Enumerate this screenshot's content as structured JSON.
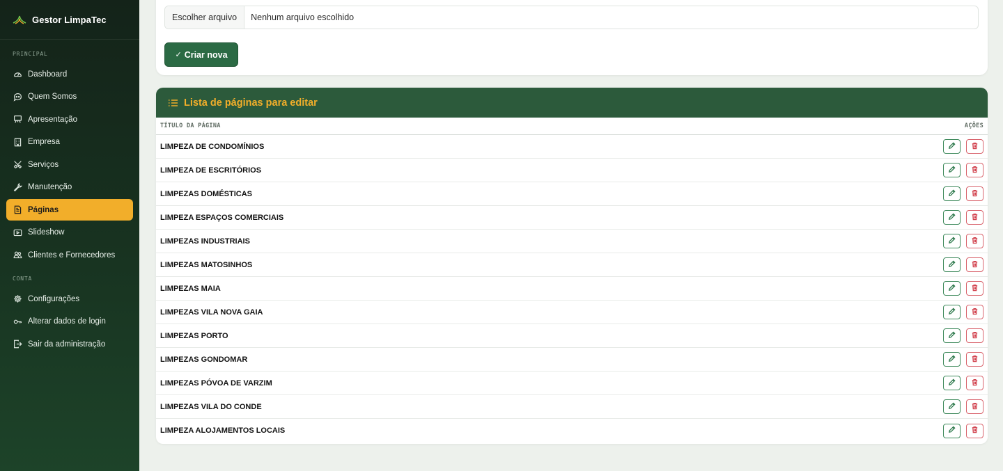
{
  "sidebar": {
    "brand": "Gestor LimpaTec",
    "section_principal": "PRINCIPAL",
    "section_conta": "CONTA",
    "principal_items": [
      {
        "label": "Dashboard",
        "icon": "gauge-icon"
      },
      {
        "label": "Quem Somos",
        "icon": "chat-quote-icon"
      },
      {
        "label": "Apresentação",
        "icon": "easel-icon"
      },
      {
        "label": "Empresa",
        "icon": "building-icon"
      },
      {
        "label": "Serviços",
        "icon": "tools-icon"
      },
      {
        "label": "Manutenção",
        "icon": "wrench-icon"
      },
      {
        "label": "Páginas",
        "icon": "file-text-icon",
        "active": true
      },
      {
        "label": "Slideshow",
        "icon": "slideshow-icon"
      },
      {
        "label": "Clientes e Fornecedores",
        "icon": "people-icon"
      }
    ],
    "conta_items": [
      {
        "label": "Configurações",
        "icon": "gear-icon"
      },
      {
        "label": "Alterar dados de login",
        "icon": "key-icon"
      },
      {
        "label": "Sair da administração",
        "icon": "logout-icon"
      }
    ]
  },
  "upload": {
    "choose_file_label": "Escolher arquivo",
    "no_file_text": "Nenhum arquivo escolhido",
    "create_button": "Criar nova"
  },
  "list": {
    "title": "Lista de páginas para editar",
    "col_title": "TÍTULO DA PÁGINA",
    "col_actions": "AÇÕES",
    "rows": [
      "LIMPEZA DE CONDOMÍNIOS",
      "LIMPEZA DE ESCRITÓRIOS",
      "LIMPEZAS DOMÉSTICAS",
      "LIMPEZA ESPAÇOS COMERCIAIS",
      "LIMPEZAS INDUSTRIAIS",
      "LIMPEZAS MATOSINHOS",
      "LIMPEZAS MAIA",
      "LIMPEZAS VILA NOVA GAIA",
      "LIMPEZAS PORTO",
      "LIMPEZAS GONDOMAR",
      "LIMPEZAS PÓVOA DE VARZIM",
      "LIMPEZAS VILA DO CONDE",
      "LIMPEZA ALOJAMENTOS LOCAIS"
    ]
  },
  "colors": {
    "sidebar_bg": "#17301f",
    "accent": "#f2ae2a",
    "primary_green": "#2c5a3b",
    "danger": "#d2434f"
  }
}
